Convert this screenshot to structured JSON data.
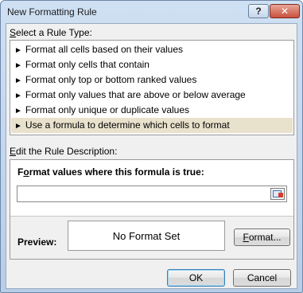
{
  "window": {
    "title": "New Formatting Rule",
    "help_label": "?",
    "close_label": "✕"
  },
  "rule_type": {
    "label_prefix": "",
    "label_hotkey": "S",
    "label_rest": "elect a Rule Type:",
    "items": [
      {
        "label": "Format all cells based on their values",
        "selected": false
      },
      {
        "label": "Format only cells that contain",
        "selected": false
      },
      {
        "label": "Format only top or bottom ranked values",
        "selected": false
      },
      {
        "label": "Format only values that are above or below average",
        "selected": false
      },
      {
        "label": "Format only unique or duplicate values",
        "selected": false
      },
      {
        "label": "Use a formula to determine which cells to format",
        "selected": true
      }
    ]
  },
  "description": {
    "label_hotkey": "E",
    "label_rest": "dit the Rule Description:",
    "formula_label_prefix": "F",
    "formula_label_hotkey": "o",
    "formula_label_rest": "rmat values where this formula is true:",
    "formula_value": "",
    "preview_label": "Preview:",
    "preview_text": "No Format Set",
    "format_hotkey": "F",
    "format_rest": "ormat..."
  },
  "footer": {
    "ok_label": "OK",
    "cancel_label": "Cancel"
  },
  "icons": {
    "arrow": "►",
    "collapse": "range-selector-icon"
  }
}
